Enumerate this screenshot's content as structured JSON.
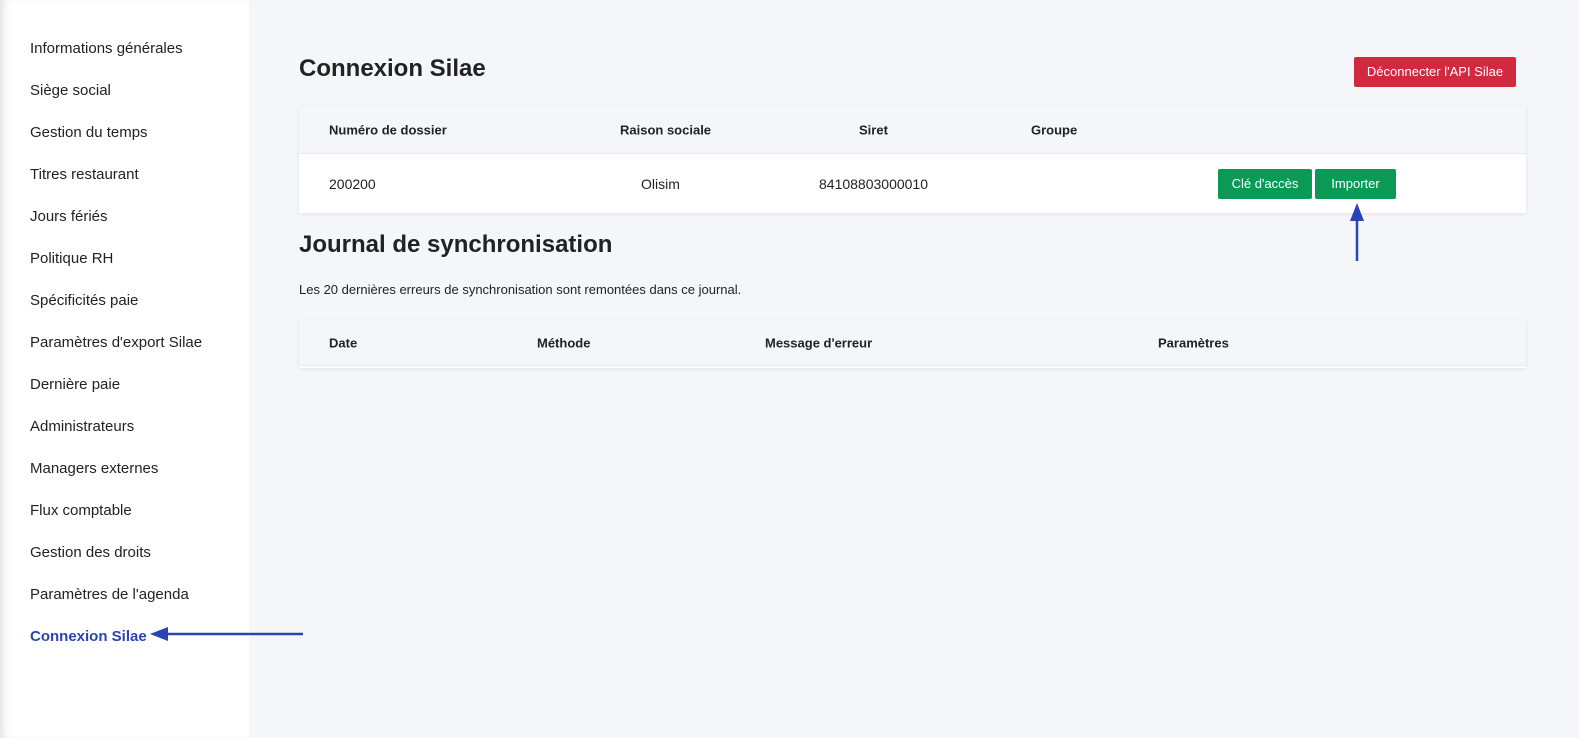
{
  "sidebar": {
    "items": [
      {
        "label": "Informations générales"
      },
      {
        "label": "Siège social"
      },
      {
        "label": "Gestion du temps"
      },
      {
        "label": "Titres restaurant"
      },
      {
        "label": "Jours fériés"
      },
      {
        "label": "Politique RH"
      },
      {
        "label": "Spécificités paie"
      },
      {
        "label": "Paramètres d'export Silae"
      },
      {
        "label": "Dernière paie"
      },
      {
        "label": "Administrateurs"
      },
      {
        "label": "Managers externes"
      },
      {
        "label": "Flux comptable"
      },
      {
        "label": "Gestion des droits"
      },
      {
        "label": "Paramètres de l'agenda"
      },
      {
        "label": "Connexion Silae",
        "active": true
      }
    ]
  },
  "main": {
    "title": "Connexion Silae",
    "disconnect_label": "Déconnecter l'API Silae",
    "connection_table": {
      "headers": [
        "Numéro de dossier",
        "Raison sociale",
        "Siret",
        "Groupe"
      ],
      "row": {
        "dossier": "200200",
        "raison_sociale": "Olisim",
        "siret": "84108803000010",
        "groupe": "",
        "access_key_label": "Clé d'accès",
        "import_label": "Importer"
      }
    },
    "journal": {
      "title": "Journal de synchronisation",
      "description": "Les 20 dernières erreurs de synchronisation sont remontées dans ce journal.",
      "headers": [
        "Date",
        "Méthode",
        "Message d'erreur",
        "Paramètres"
      ]
    }
  },
  "colors": {
    "accent": "#2b44b5",
    "danger": "#d12a3f",
    "success": "#0a9a55",
    "background": "#f5f6fa"
  }
}
